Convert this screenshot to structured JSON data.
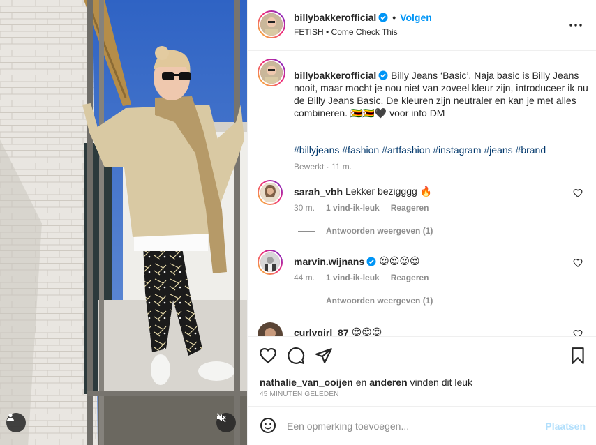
{
  "post": {
    "username": "billybakkerofficial",
    "follow_label": "Volgen",
    "header_sub": "FETISH • Come Check This",
    "more_icon": "more-horizontal-icon",
    "caption_text": "Billy Jeans ‘Basic’, Naja basic is Billy Jeans nooit, maar mocht je nou niet van zoveel kleur zijn, introduceer ik nu de Billy Jeans Basic. De kleuren zijn neutraler en kan je met alles combineren. 🇿🇼🇿🇼🖤 voor info DM",
    "hashtags": "#billyjeans #fashion #artfashion #instagram #jeans #brand",
    "caption_meta": "Bewerkt · 11 m."
  },
  "comments": [
    {
      "username": "sarah_vbh",
      "text": "Lekker bezigggg 🔥",
      "time": "30 m.",
      "likes": "1 vind-ik-leuk",
      "reply": "Reageren",
      "replies_label": "Antwoorden weergeven (1)",
      "verified": false
    },
    {
      "username": "marvin.wijnans",
      "text": "😍😍😍😍",
      "time": "44 m.",
      "likes": "1 vind-ik-leuk",
      "reply": "Reageren",
      "replies_label": "Antwoorden weergeven (1)",
      "verified": true
    },
    {
      "username": "curlygirl_87",
      "text": "😍😍😍",
      "verified": false
    }
  ],
  "actions": {
    "liked_by_user": "nathalie_van_ooijen",
    "liked_by_mid": " en ",
    "liked_by_others": "anderen",
    "liked_by_tail": " vinden dit leuk",
    "timestamp": "45 MINUTEN GELEDEN"
  },
  "add_comment": {
    "placeholder": "Een opmerking toevoegen...",
    "post_label": "Plaatsen"
  },
  "colors": {
    "link_blue": "#0095f6",
    "hashtag_blue": "#00376b",
    "muted": "#8e8e8e",
    "post_disabled": "#b2dffc"
  }
}
